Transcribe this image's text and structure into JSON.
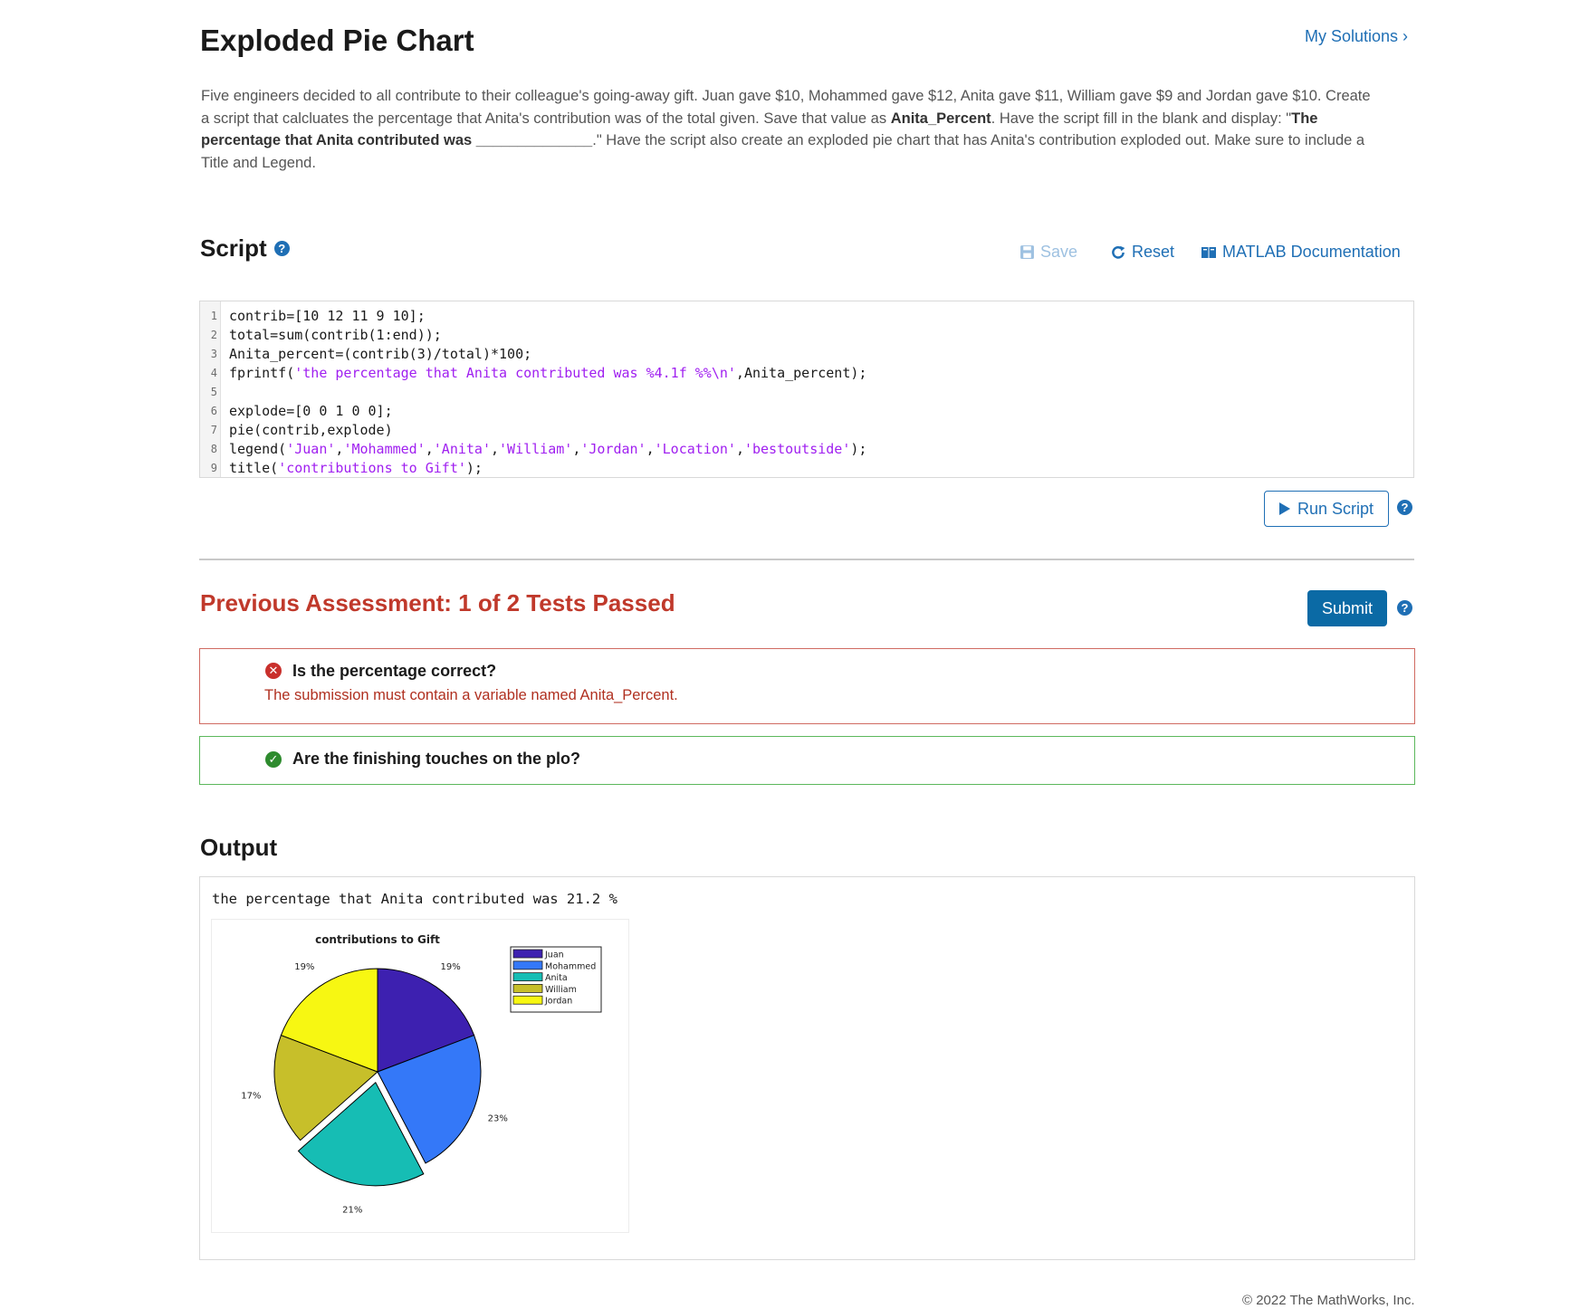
{
  "header": {
    "title": "Exploded Pie Chart",
    "my_solutions": "My Solutions ›"
  },
  "problem": {
    "p1": "Five engineers decided to all contribute to their colleague's going-away gift.  Juan gave $10, Mohammed gave $12, Anita gave $11, William gave $9 and Jordan gave $10.  Create a script that calcluates the percentage that Anita's contribution was of the total given. Save that value as ",
    "var_name": "Anita_Percent",
    "p2": ". Have the script fill in the blank and display:  \"",
    "display_bold": "The percentage that Anita contributed was ______________",
    "p3": ".\" Have the script also create an exploded pie chart that has Anita's contribution exploded out. Make sure to include a Title and Legend."
  },
  "script": {
    "title": "Script",
    "help_icon": "?",
    "save_label": "Save",
    "reset_label": "Reset",
    "docs_label": "MATLAB Documentation",
    "lines": [
      {
        "n": "1",
        "parts": [
          {
            "t": "contrib=[10 12 11 9 10];",
            "s": false
          }
        ]
      },
      {
        "n": "2",
        "parts": [
          {
            "t": "total=sum(contrib(1:end));",
            "s": false
          }
        ]
      },
      {
        "n": "3",
        "parts": [
          {
            "t": "Anita_percent=(contrib(3)/total)*100;",
            "s": false
          }
        ]
      },
      {
        "n": "4",
        "parts": [
          {
            "t": "fprintf(",
            "s": false
          },
          {
            "t": "'the percentage that Anita contributed was %4.1f %%\\n'",
            "s": true
          },
          {
            "t": ",Anita_percent);",
            "s": false
          }
        ]
      },
      {
        "n": "5",
        "parts": []
      },
      {
        "n": "6",
        "parts": [
          {
            "t": "explode=[0 0 1 0 0];",
            "s": false
          }
        ]
      },
      {
        "n": "7",
        "parts": [
          {
            "t": "pie(contrib,explode)",
            "s": false
          }
        ]
      },
      {
        "n": "8",
        "parts": [
          {
            "t": "legend(",
            "s": false
          },
          {
            "t": "'Juan'",
            "s": true
          },
          {
            "t": ",",
            "s": false
          },
          {
            "t": "'Mohammed'",
            "s": true
          },
          {
            "t": ",",
            "s": false
          },
          {
            "t": "'Anita'",
            "s": true
          },
          {
            "t": ",",
            "s": false
          },
          {
            "t": "'William'",
            "s": true
          },
          {
            "t": ",",
            "s": false
          },
          {
            "t": "'Jordan'",
            "s": true
          },
          {
            "t": ",",
            "s": false
          },
          {
            "t": "'Location'",
            "s": true
          },
          {
            "t": ",",
            "s": false
          },
          {
            "t": "'bestoutside'",
            "s": true
          },
          {
            "t": ");",
            "s": false
          }
        ]
      },
      {
        "n": "9",
        "parts": [
          {
            "t": "title(",
            "s": false
          },
          {
            "t": "'contributions to Gift'",
            "s": true
          },
          {
            "t": ");",
            "s": false
          }
        ]
      }
    ],
    "run_label": "Run Script"
  },
  "assessment": {
    "title": "Previous Assessment: 1 of 2 Tests Passed",
    "submit_label": "Submit",
    "tests": [
      {
        "name": "Is the percentage correct?",
        "message": "The submission must contain a variable named Anita_Percent.",
        "status": "fail"
      },
      {
        "name": "Are the finishing touches on the plo?",
        "message": "",
        "status": "pass"
      }
    ]
  },
  "output": {
    "title": "Output",
    "text": "the percentage that Anita contributed was 21.2 %"
  },
  "chart_data": {
    "type": "pie",
    "title": "contributions to Gift",
    "categories": [
      "Juan",
      "Mohammed",
      "Anita",
      "William",
      "Jordan"
    ],
    "values": [
      10,
      12,
      11,
      9,
      10
    ],
    "labels": [
      "19%",
      "23%",
      "21%",
      "17%",
      "19%"
    ],
    "explode": [
      0,
      0,
      1,
      0,
      0
    ],
    "colors": [
      "#3d20b0",
      "#3478f8",
      "#16bdb4",
      "#c7bf2a",
      "#f7f712"
    ],
    "legend": {
      "entries": [
        "Juan",
        "Mohammed",
        "Anita",
        "William",
        "Jordan"
      ],
      "placement": "top-right"
    }
  },
  "footer": {
    "copyright": "© 2022 The MathWorks, Inc."
  }
}
